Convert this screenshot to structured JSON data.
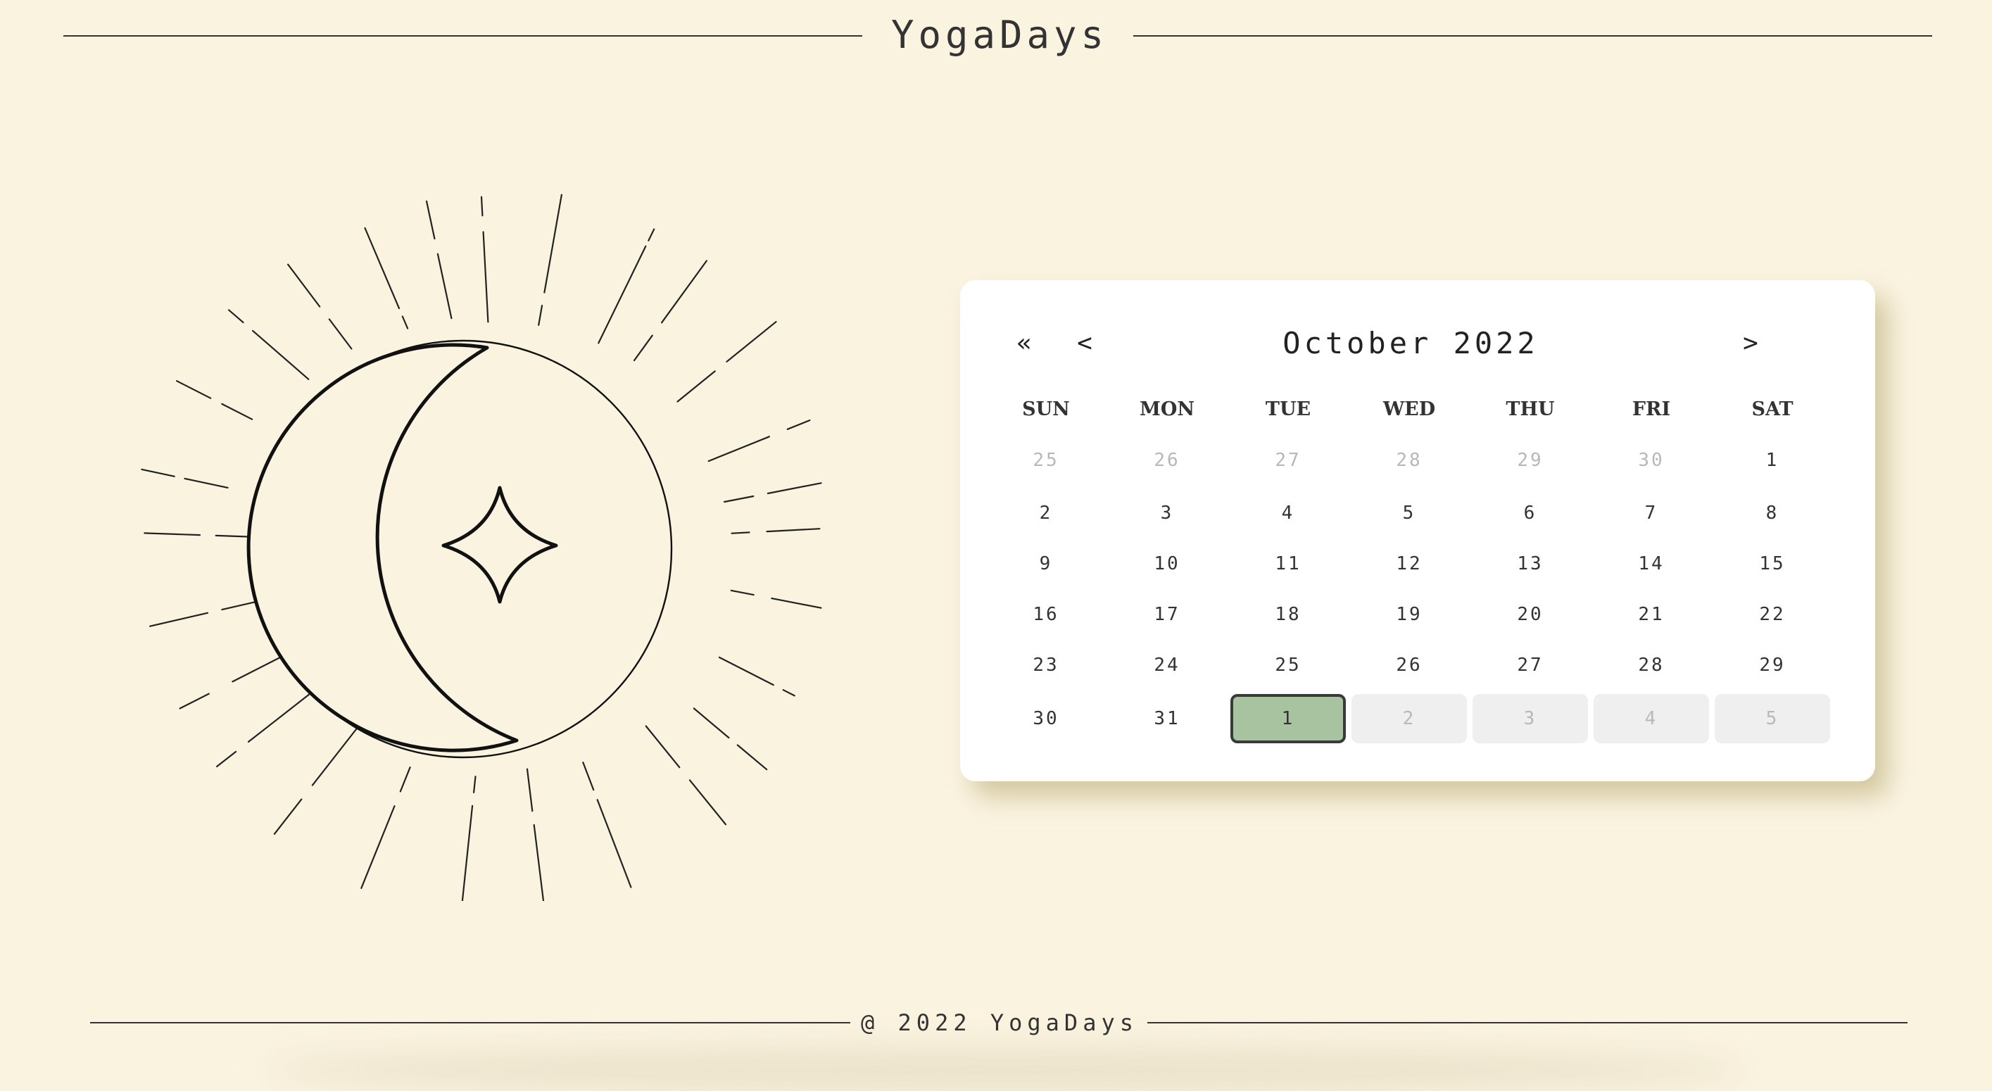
{
  "header": {
    "title": "YogaDays"
  },
  "footer": {
    "text": "@ 2022 YogaDays"
  },
  "calendar": {
    "month_label": "October 2022",
    "prev_year_label": "«",
    "prev_month_label": "<",
    "next_month_label": ">",
    "weekdays": [
      "SUN",
      "MON",
      "TUE",
      "WED",
      "THU",
      "FRI",
      "SAT"
    ],
    "weeks": [
      [
        {
          "label": "25",
          "state": "muted"
        },
        {
          "label": "26",
          "state": "muted"
        },
        {
          "label": "27",
          "state": "muted"
        },
        {
          "label": "28",
          "state": "muted"
        },
        {
          "label": "29",
          "state": "muted"
        },
        {
          "label": "30",
          "state": "muted"
        },
        {
          "label": "1",
          "state": "normal"
        }
      ],
      [
        {
          "label": "2",
          "state": "normal"
        },
        {
          "label": "3",
          "state": "normal"
        },
        {
          "label": "4",
          "state": "normal"
        },
        {
          "label": "5",
          "state": "normal"
        },
        {
          "label": "6",
          "state": "normal"
        },
        {
          "label": "7",
          "state": "normal"
        },
        {
          "label": "8",
          "state": "normal"
        }
      ],
      [
        {
          "label": "9",
          "state": "normal"
        },
        {
          "label": "10",
          "state": "normal"
        },
        {
          "label": "11",
          "state": "normal"
        },
        {
          "label": "12",
          "state": "normal"
        },
        {
          "label": "13",
          "state": "normal"
        },
        {
          "label": "14",
          "state": "normal"
        },
        {
          "label": "15",
          "state": "normal"
        }
      ],
      [
        {
          "label": "16",
          "state": "normal"
        },
        {
          "label": "17",
          "state": "normal"
        },
        {
          "label": "18",
          "state": "normal"
        },
        {
          "label": "19",
          "state": "normal"
        },
        {
          "label": "20",
          "state": "normal"
        },
        {
          "label": "21",
          "state": "normal"
        },
        {
          "label": "22",
          "state": "normal"
        }
      ],
      [
        {
          "label": "23",
          "state": "normal"
        },
        {
          "label": "24",
          "state": "normal"
        },
        {
          "label": "25",
          "state": "normal"
        },
        {
          "label": "26",
          "state": "normal"
        },
        {
          "label": "27",
          "state": "normal"
        },
        {
          "label": "28",
          "state": "normal"
        },
        {
          "label": "29",
          "state": "normal"
        }
      ],
      [
        {
          "label": "30",
          "state": "normal"
        },
        {
          "label": "31",
          "state": "normal"
        },
        {
          "label": "1",
          "state": "selected"
        },
        {
          "label": "2",
          "state": "shaded"
        },
        {
          "label": "3",
          "state": "shaded"
        },
        {
          "label": "4",
          "state": "shaded"
        },
        {
          "label": "5",
          "state": "shaded"
        }
      ]
    ]
  },
  "illustration": {
    "icon": "sun-moon-star-icon"
  },
  "colors": {
    "background": "#faf3e0",
    "card": "#ffffff",
    "selected_day": "#a8c3a0",
    "shaded_day": "#efefef",
    "muted_text": "#b8b8b8",
    "line": "#333333"
  }
}
